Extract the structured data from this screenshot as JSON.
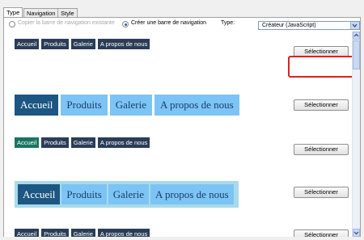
{
  "tabs": [
    {
      "label": "Type",
      "active": true
    },
    {
      "label": "Navigation",
      "active": false
    },
    {
      "label": "Style",
      "active": false
    }
  ],
  "options": {
    "copy_label": "Copier la barre de navigation existante",
    "create_label": "Créer une barre de navigation",
    "selected": "create",
    "type_label": "Type:",
    "type_value": "Créateur (JavaScript)"
  },
  "styles": [
    {
      "items": [
        "Accueil",
        "Produits",
        "Galerie",
        "A propos de nous"
      ],
      "button": "Sélectionner"
    },
    {
      "items": [
        "Accueil",
        "Produits",
        "Galerie",
        "A propos de nous"
      ],
      "button": "Sélectionner"
    },
    {
      "items": [
        "Accueil",
        "Produits",
        "Galerie",
        "A propos de nous"
      ],
      "button": "Sélectionner"
    },
    {
      "items": [
        "Accueil",
        "Produits",
        "Galerie",
        "A propos de nous"
      ],
      "button": "Sélectionner"
    },
    {
      "items": [
        "Accueil",
        "Produits",
        "Galerie",
        "A propos de nous"
      ],
      "button": "Sélectionner"
    }
  ],
  "colors": {
    "nav_dark": "#2a3d58",
    "nav_light": "#7cc4f6",
    "nav_active": "#1c5682",
    "nav_green": "#1a7560",
    "highlight": "#e02020"
  }
}
